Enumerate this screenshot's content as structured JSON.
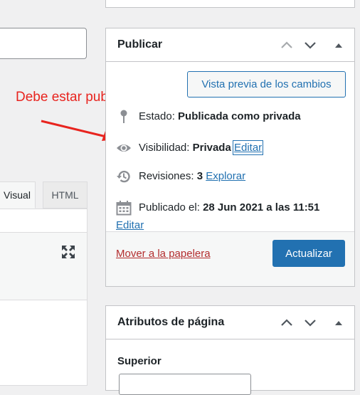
{
  "annotation": {
    "text": "Debe estar publica",
    "color": "#e8241f"
  },
  "editor": {
    "tabs": [
      {
        "label": "Visual"
      },
      {
        "label": "HTML"
      }
    ],
    "fullscreen_icon": "fullscreen-icon"
  },
  "publish_box": {
    "title": "Publicar",
    "header_buttons": [
      "chevron-up-icon",
      "chevron-down-icon",
      "triangle-up-icon"
    ],
    "preview_button": "Vista previa de los cambios",
    "status": {
      "icon": "pin-icon",
      "label": "Estado:",
      "value": "Publicada como privada"
    },
    "visibility": {
      "icon": "eye-icon",
      "label": "Visibilidad:",
      "value": "Privada",
      "edit_link": "Editar"
    },
    "revisions": {
      "icon": "history-icon",
      "label": "Revisiones:",
      "value": "3",
      "link": "Explorar"
    },
    "published": {
      "icon": "calendar-icon",
      "label": "Publicado el:",
      "value": "28 Jun 2021 a las 11:51",
      "edit_link": "Editar"
    },
    "trash_link": "Mover a la papelera",
    "update_button": "Actualizar",
    "accent_color": "#2271b1",
    "trash_color": "#b32d2e"
  },
  "attributes_box": {
    "title": "Atributos de página",
    "parent_label": "Superior"
  }
}
